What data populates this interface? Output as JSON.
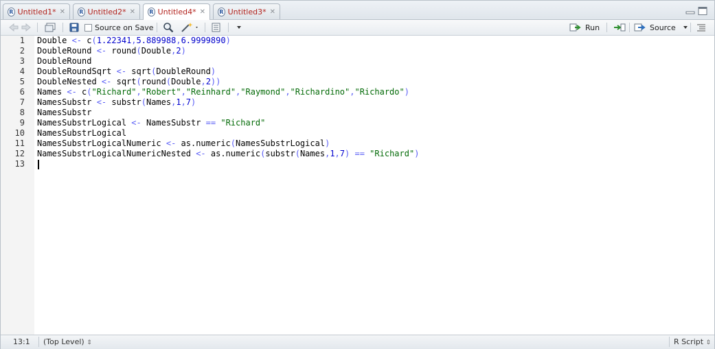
{
  "tabs": [
    {
      "label": "Untitled1*",
      "active": false
    },
    {
      "label": "Untitled2*",
      "active": false
    },
    {
      "label": "Untitled4*",
      "active": true
    },
    {
      "label": "Untitled3*",
      "active": false
    }
  ],
  "toolbar": {
    "source_on_save_label": "Source on Save",
    "source_on_save_checked": false,
    "run_label": "Run",
    "source_label": "Source"
  },
  "editor": {
    "line_numbers": [
      "1",
      "2",
      "3",
      "4",
      "5",
      "6",
      "7",
      "8",
      "9",
      "10",
      "11",
      "12",
      "13"
    ],
    "lines": [
      "Double <- c(1.22341,5.889988,6.9999890)",
      "DoubleRound <- round(Double,2)",
      "DoubleRound",
      "DoubleRoundSqrt <- sqrt(DoubleRound)",
      "DoubleNested <- sqrt(round(Double,2))",
      "Names <- c(\"Richard\",\"Robert\",\"Reinhard\",\"Raymond\",\"Richardino\",\"Richardo\")",
      "NamesSubstr <- substr(Names,1,7)",
      "NamesSubstr",
      "NamesSubstrLogical <- NamesSubstr == \"Richard\"",
      "NamesSubstrLogical",
      "NamesSubstrLogicalNumeric <- as.numeric(NamesSubstrLogical)",
      "NamesSubstrLogicalNumericNested <- as.numeric(substr(Names,1,7) == \"Richard\")",
      ""
    ]
  },
  "status": {
    "position": "13:1",
    "scope": "(Top Level)",
    "language": "R Script"
  },
  "colors": {
    "operator": "#585cf6",
    "number": "#0000cd",
    "string": "#036a07",
    "tab_label": "#b2221c"
  },
  "icons": [
    "back-arrow-icon",
    "forward-arrow-icon",
    "show-in-window-icon",
    "save-icon",
    "search-icon",
    "magic-wand-icon",
    "compile-notebook-icon",
    "run-icon",
    "rerun-icon",
    "source-icon",
    "outline-icon",
    "minimize-icon",
    "maximize-icon",
    "close-icon"
  ]
}
